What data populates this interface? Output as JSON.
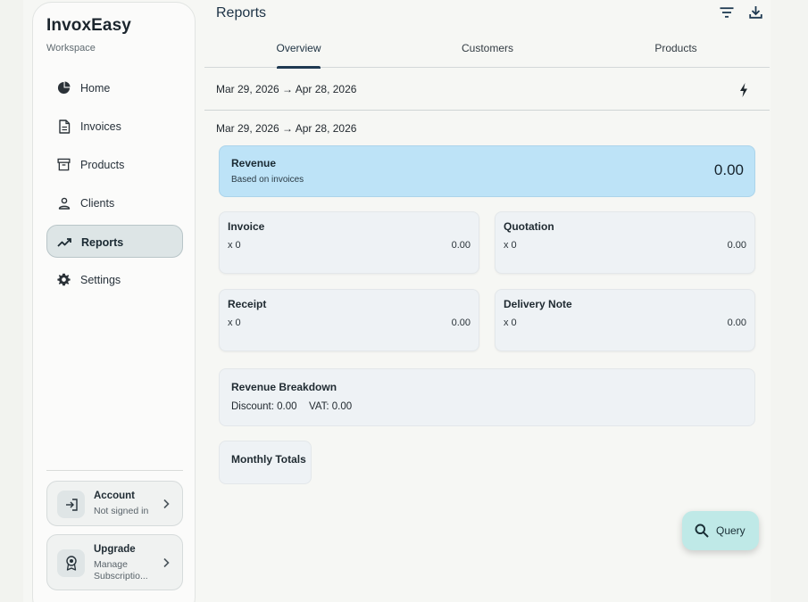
{
  "sidebar": {
    "brand": "InvoxEasy",
    "subtitle": "Workspace",
    "items": [
      {
        "label": "Home",
        "icon": "pie-chart-icon"
      },
      {
        "label": "Invoices",
        "icon": "document-icon"
      },
      {
        "label": "Products",
        "icon": "archive-box-icon"
      },
      {
        "label": "Clients",
        "icon": "person-icon"
      },
      {
        "label": "Reports",
        "icon": "trending-up-icon",
        "active": true
      },
      {
        "label": "Settings",
        "icon": "gear-icon"
      }
    ],
    "account": {
      "title": "Account",
      "subtitle": "Not signed in"
    },
    "upgrade": {
      "title": "Upgrade",
      "subtitle_line1": "Manage",
      "subtitle_line2": "Subscriptio..."
    }
  },
  "header": {
    "title": "Reports",
    "filter_icon": "filter-icon",
    "download_icon": "download-icon"
  },
  "tabs": [
    {
      "label": "Overview",
      "active": true
    },
    {
      "label": "Customers"
    },
    {
      "label": "Products"
    }
  ],
  "range": {
    "label": "Mar 29, 2026 → Apr 28, 2026",
    "summary_label": "Mar 29, 2026 → Apr 28, 2026"
  },
  "revenue": {
    "title": "Revenue",
    "subtitle": "Based on invoices",
    "value": "0.00"
  },
  "documents": {
    "invoice": {
      "title": "Invoice",
      "count": "x 0",
      "amount": "0.00"
    },
    "quotation": {
      "title": "Quotation",
      "count": "x 0",
      "amount": "0.00"
    },
    "receipt": {
      "title": "Receipt",
      "count": "x 0",
      "amount": "0.00"
    },
    "delivery_note": {
      "title": "Delivery Note",
      "count": "x 0",
      "amount": "0.00"
    }
  },
  "breakdown": {
    "title": "Revenue Breakdown",
    "discount": "Discount: 0.00",
    "vat": "VAT: 0.00"
  },
  "monthly": {
    "title": "Monthly Totals"
  },
  "fab": {
    "label": "Query"
  },
  "colors": {
    "accent": "#1f3a52",
    "revenue_bg": "#bde3f7",
    "fab_bg": "#bfe9e7",
    "active_nav": "#dde5e6"
  }
}
